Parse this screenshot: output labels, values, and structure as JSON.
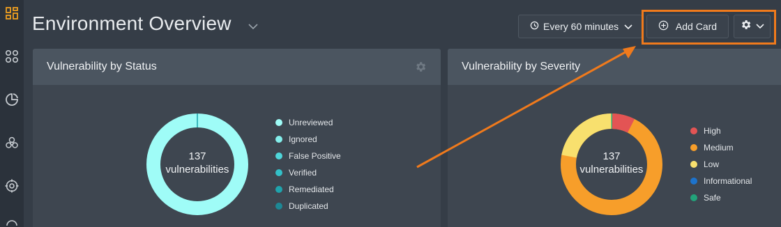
{
  "header": {
    "title": "Environment Overview",
    "refresh_label": "Every 60 minutes",
    "add_card_label": "Add Card"
  },
  "cards": [
    {
      "title": "Vulnerability by Status",
      "center_count": "137",
      "center_label": "vulnerabilities",
      "legend": [
        {
          "label": "Unreviewed",
          "color": "#9ffcf7"
        },
        {
          "label": "Ignored",
          "color": "#84efec"
        },
        {
          "label": "False Positive",
          "color": "#4fd6da"
        },
        {
          "label": "Verified",
          "color": "#33c0c8"
        },
        {
          "label": "Remediated",
          "color": "#1fa4ad"
        },
        {
          "label": "Duplicated",
          "color": "#1d8895"
        }
      ]
    },
    {
      "title": "Vulnerability by Severity",
      "center_count": "137",
      "center_label": "vulnerabilities",
      "legend": [
        {
          "label": "High",
          "color": "#e35454"
        },
        {
          "label": "Medium",
          "color": "#f79e2a"
        },
        {
          "label": "Low",
          "color": "#f8e06e"
        },
        {
          "label": "Informational",
          "color": "#1d73cc"
        },
        {
          "label": "Safe",
          "color": "#22a37a"
        }
      ]
    }
  ],
  "colors": {
    "highlight": "#f07a1c",
    "accent": "#f0a020"
  },
  "icons": [
    "dashboard-icon",
    "apps-icon",
    "reports-icon",
    "biohazard-icon",
    "target-icon",
    "clock-icon",
    "plus-circle-icon",
    "gear-icon",
    "chevron-down-icon"
  ]
}
